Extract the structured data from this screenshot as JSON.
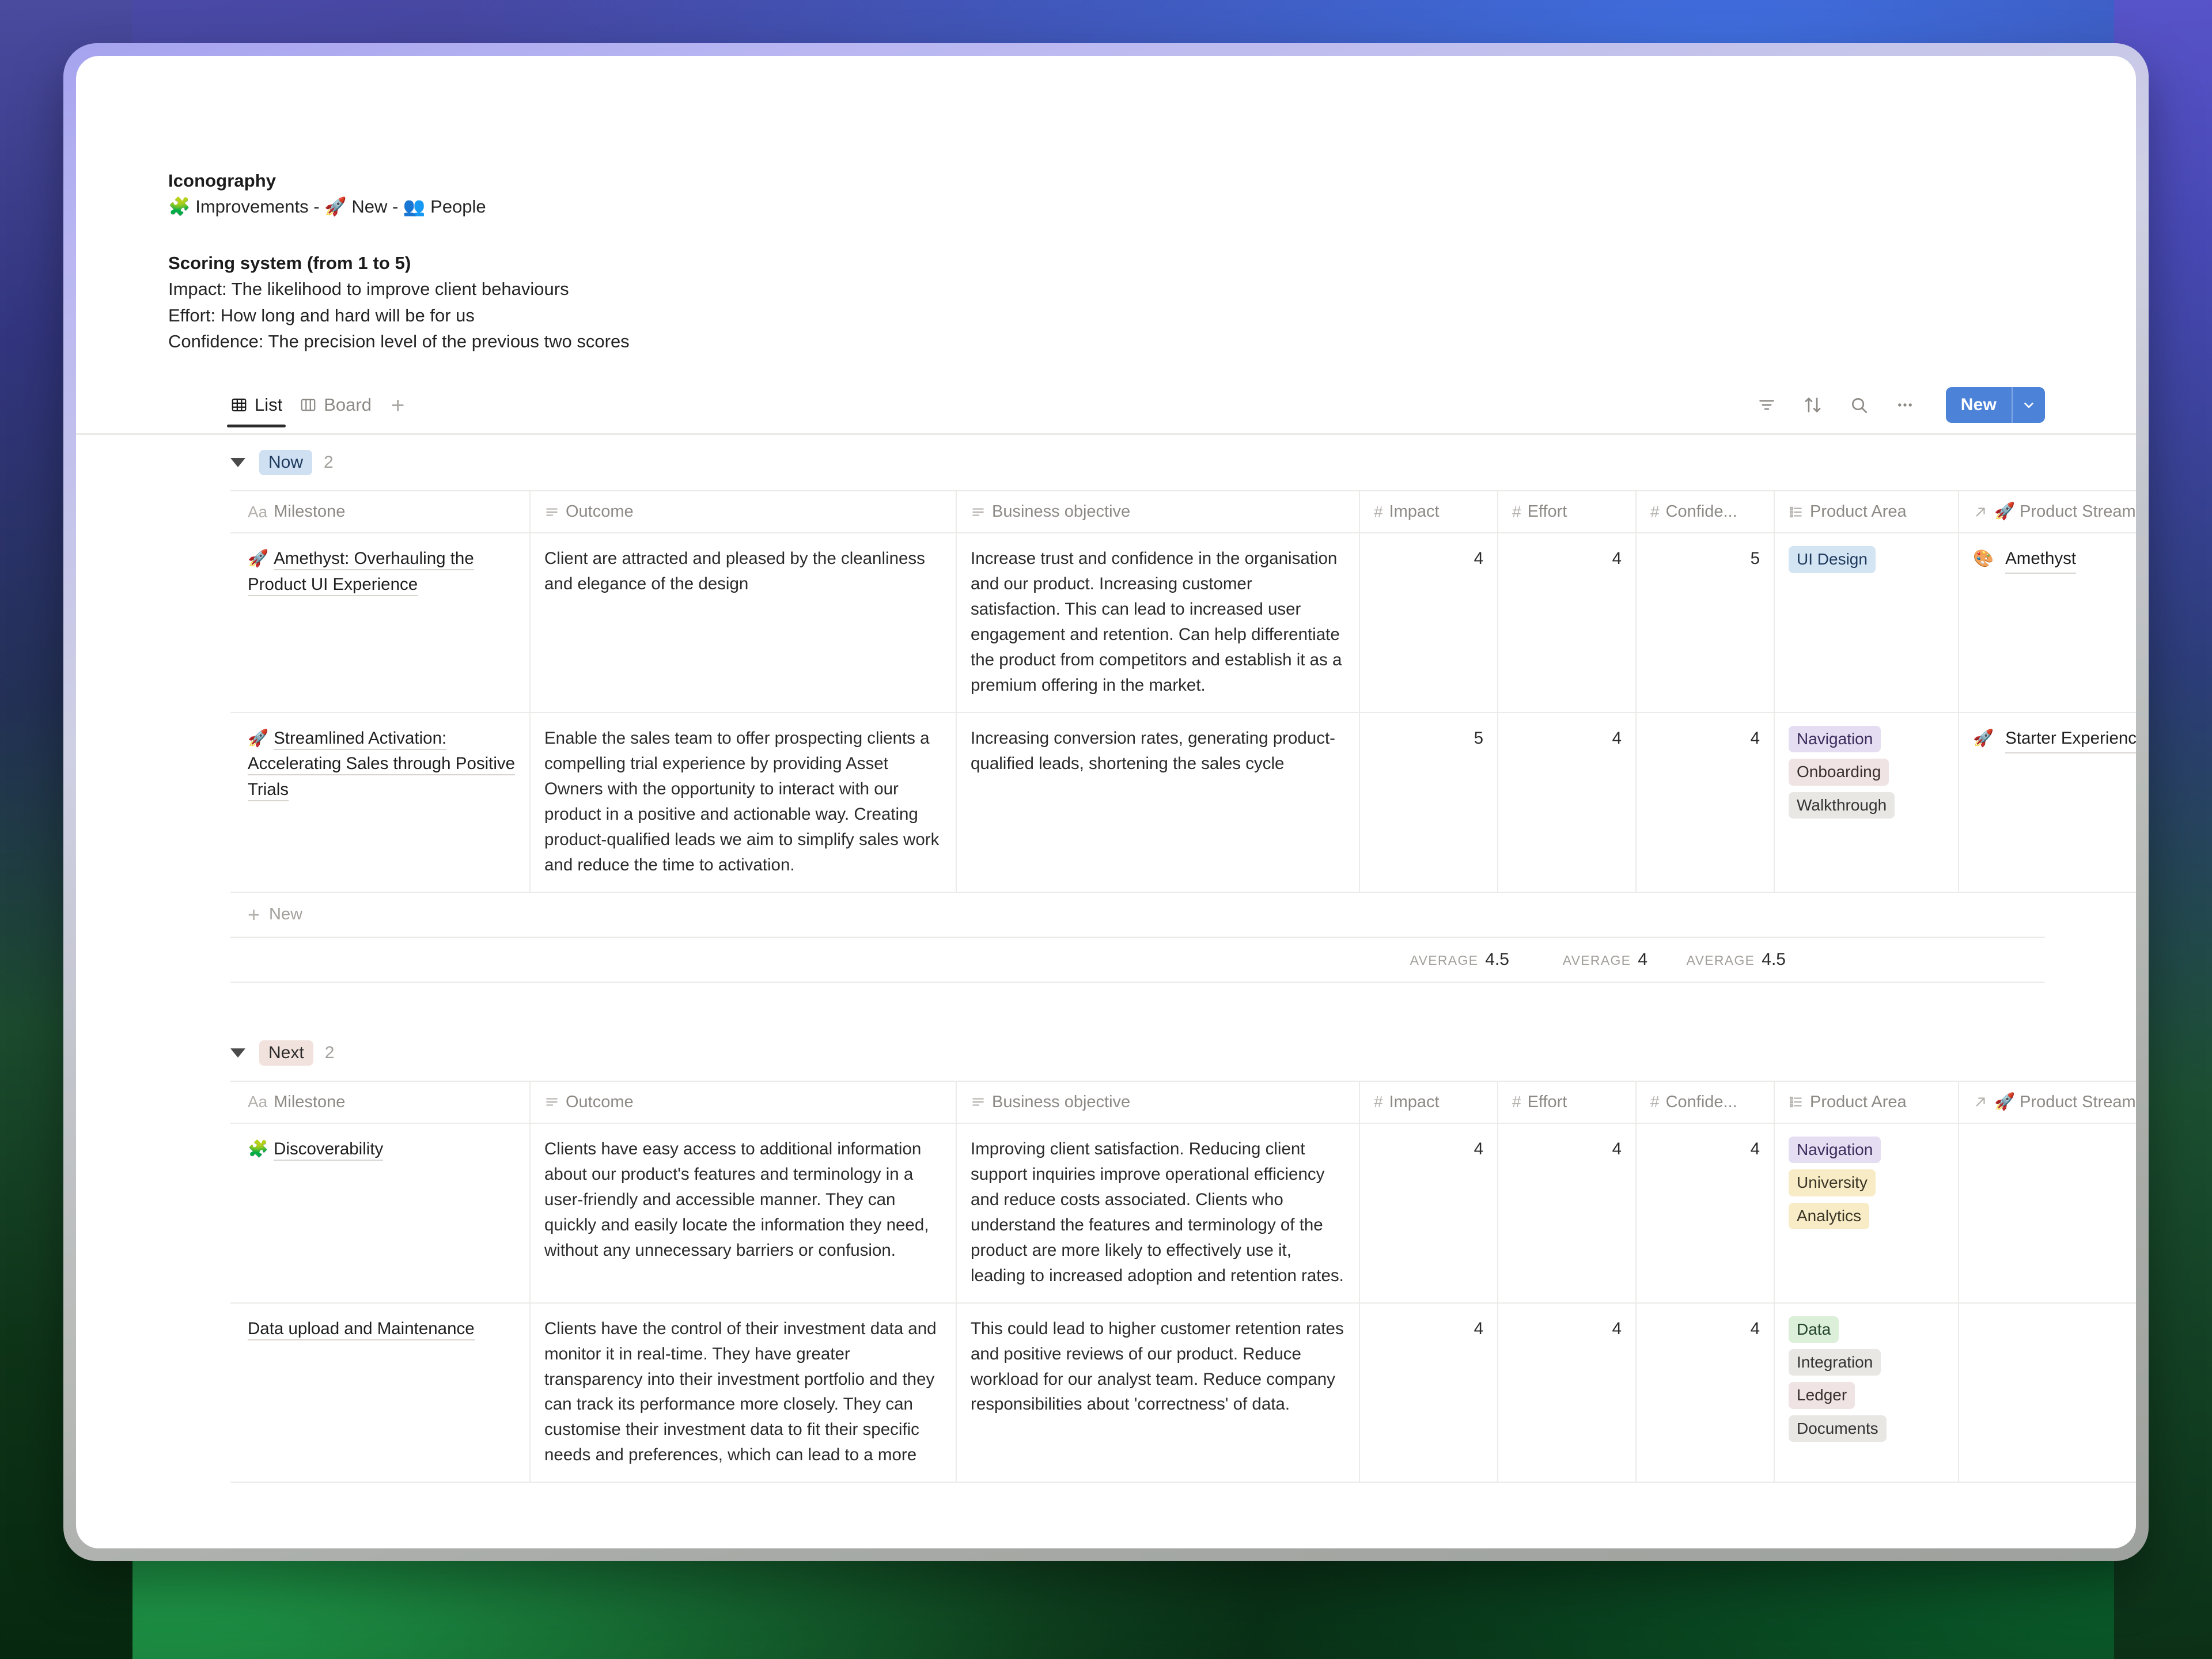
{
  "notes": {
    "iconography_title": "Iconography",
    "iconography_line": "🧩 Improvements - 🚀 New - 👥 People",
    "scoring_title": "Scoring system (from 1 to 5)",
    "scoring_impact": "Impact: The likelihood to improve client behaviours",
    "scoring_effort": "Effort: How long and hard will be for us",
    "scoring_confidence": "Confidence: The precision level of the previous two scores"
  },
  "viewbar": {
    "tabs": [
      {
        "label": "List",
        "icon": "table-icon",
        "active": true
      },
      {
        "label": "Board",
        "icon": "board-icon",
        "active": false
      }
    ],
    "add_view_label": "+",
    "icons": [
      "filter-icon",
      "sort-icon",
      "search-icon",
      "more-icon"
    ],
    "new_button_label": "New",
    "new_button_color": "#4c82d8"
  },
  "columns": [
    {
      "label": "Milestone",
      "glyph": "Aa",
      "type": "title"
    },
    {
      "label": "Outcome",
      "glyph": "text-icon",
      "type": "text"
    },
    {
      "label": "Business objective",
      "glyph": "text-icon",
      "type": "text"
    },
    {
      "label": "Impact",
      "glyph": "#",
      "type": "number"
    },
    {
      "label": "Effort",
      "glyph": "#",
      "type": "number"
    },
    {
      "label": "Confide...",
      "glyph": "#",
      "type": "number"
    },
    {
      "label": "Product Area",
      "glyph": "multiselect-icon",
      "type": "tags"
    },
    {
      "label": "🚀 Product Streams",
      "glyph": "relation-icon",
      "type": "relation"
    }
  ],
  "groups": [
    {
      "name": "Now",
      "count": "2",
      "pill_style": "now",
      "rows": [
        {
          "emoji": "🚀",
          "milestone": "Amethyst: Overhauling the Product UI Experience",
          "outcome": "Client are attracted and pleased by the cleanliness and elegance of the design",
          "objective": "Increase trust and confidence in the organisation and our product. Increasing customer satisfaction. This can lead to increased user engagement and retention. Can help differentiate the product from competitors and establish it as a premium offering in the market.",
          "impact": "4",
          "effort": "4",
          "confidence": "5",
          "product_area": [
            {
              "label": "UI Design",
              "color": "blue"
            }
          ],
          "stream_emoji": "🎨",
          "stream": "Amethyst"
        },
        {
          "emoji": "🚀",
          "milestone": "Streamlined Activation: Accelerating Sales through Positive Trials",
          "outcome": "Enable the sales team to offer prospecting clients a compelling trial experience by providing Asset Owners with the opportunity to interact with our product in a positive and actionable way. Creating product-qualified leads we aim to simplify sales work and reduce the time to activation.",
          "objective": "Increasing conversion rates, generating product-qualified leads, shortening the sales cycle",
          "impact": "5",
          "effort": "4",
          "confidence": "4",
          "product_area": [
            {
              "label": "Navigation",
              "color": "purple"
            },
            {
              "label": "Onboarding",
              "color": "pink"
            },
            {
              "label": "Walkthrough",
              "color": "gray"
            }
          ],
          "stream_emoji": "🚀",
          "stream": "Starter Experience"
        }
      ],
      "new_row_label": "New",
      "summary": [
        {
          "key": "AVERAGE",
          "value": "4.5"
        },
        {
          "key": "AVERAGE",
          "value": "4"
        },
        {
          "key": "AVERAGE",
          "value": "4.5"
        }
      ]
    },
    {
      "name": "Next",
      "count": "2",
      "pill_style": "next",
      "rows": [
        {
          "emoji": "🧩",
          "milestone": "Discoverability",
          "outcome": "Clients have easy access to additional information about our product's features and terminology in a user-friendly and accessible manner. They can quickly and easily locate the information they need, without any unnecessary barriers or confusion.",
          "objective": "Improving client satisfaction. Reducing client support inquiries improve operational efficiency and reduce costs associated. Clients who understand the features and terminology of the product are more likely to effectively use it, leading to increased adoption and retention rates.",
          "impact": "4",
          "effort": "4",
          "confidence": "4",
          "product_area": [
            {
              "label": "Navigation",
              "color": "purple"
            },
            {
              "label": "University",
              "color": "yellow"
            },
            {
              "label": "Analytics",
              "color": "yellow"
            }
          ],
          "stream_emoji": "",
          "stream": ""
        },
        {
          "emoji": "",
          "milestone": "Data upload and Maintenance",
          "outcome": "Clients have the control of their investment data and monitor it in real-time. They have greater transparency into their investment portfolio and they can track its performance more closely. They can customise their investment data to fit their specific needs and preferences, which can lead to a more",
          "objective": "This could lead to higher customer retention rates and positive reviews of our product. Reduce workload for our analyst team. Reduce company responsibilities about 'correctness' of data.",
          "impact": "4",
          "effort": "4",
          "confidence": "4",
          "product_area": [
            {
              "label": "Data",
              "color": "green"
            },
            {
              "label": "Integration",
              "color": "gray"
            },
            {
              "label": "Ledger",
              "color": "pink"
            },
            {
              "label": "Documents",
              "color": "gray"
            }
          ],
          "stream_emoji": "",
          "stream": ""
        }
      ]
    }
  ]
}
